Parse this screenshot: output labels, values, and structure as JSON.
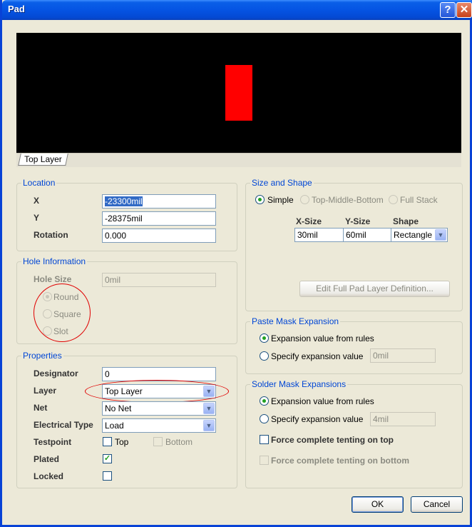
{
  "window": {
    "title": "Pad",
    "help_glyph": "?",
    "close_glyph": "✕"
  },
  "preview": {
    "layer_tab": "Top Layer",
    "pad_color": "#ff0000",
    "background": "#000000"
  },
  "location": {
    "title": "Location",
    "x_label": "X",
    "x_value": "-23300mil",
    "y_label": "Y",
    "y_value": "-28375mil",
    "rotation_label": "Rotation",
    "rotation_value": "0.000"
  },
  "hole": {
    "title": "Hole Information",
    "size_label": "Hole Size",
    "size_value": "0mil",
    "round": "Round",
    "square": "Square",
    "slot": "Slot"
  },
  "properties": {
    "title": "Properties",
    "designator_label": "Designator",
    "designator_value": "0",
    "layer_label": "Layer",
    "layer_value": "Top Layer",
    "net_label": "Net",
    "net_value": "No Net",
    "etype_label": "Electrical Type",
    "etype_value": "Load",
    "testpoint_label": "Testpoint",
    "tp_top": "Top",
    "tp_bottom": "Bottom",
    "plated_label": "Plated",
    "plated_checked": true,
    "locked_label": "Locked",
    "locked_checked": false
  },
  "size_shape": {
    "title": "Size and Shape",
    "simple": "Simple",
    "tmb": "Top-Middle-Bottom",
    "full_stack": "Full Stack",
    "col_xsize": "X-Size",
    "col_ysize": "Y-Size",
    "col_shape": "Shape",
    "xsize": "30mil",
    "ysize": "60mil",
    "shape": "Rectangle",
    "edit_button": "Edit Full Pad Layer Definition..."
  },
  "paste": {
    "title": "Paste Mask Expansion",
    "from_rules": "Expansion value from rules",
    "specify": "Specify expansion value",
    "value": "0mil"
  },
  "solder": {
    "title": "Solder Mask Expansions",
    "from_rules": "Expansion value from rules",
    "specify": "Specify expansion value",
    "value": "4mil",
    "tent_top": "Force complete tenting on top",
    "tent_bottom": "Force complete tenting on bottom"
  },
  "buttons": {
    "ok": "OK",
    "cancel": "Cancel"
  },
  "annotation_color": "#e00000"
}
